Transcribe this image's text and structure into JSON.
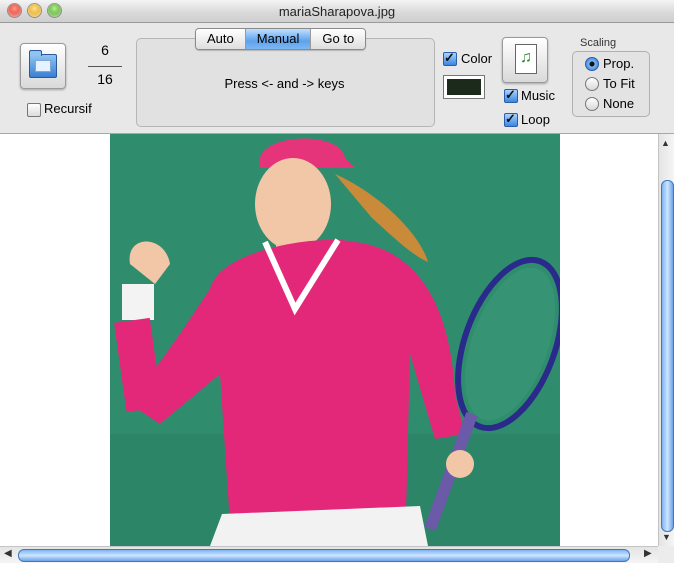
{
  "window": {
    "title": "mariaSharapova.jpg"
  },
  "toolbar": {
    "open_folder_icon": "folder-icon",
    "counter": {
      "current": "6",
      "total": "16"
    },
    "recursive_label": "Recursif",
    "recursive_checked": false,
    "modes": [
      {
        "label": "Auto",
        "active": false
      },
      {
        "label": "Manual",
        "active": true
      },
      {
        "label": "Go to",
        "active": false
      }
    ],
    "instruction": "Press <- and -> keys",
    "color_label": "Color",
    "color_checked": true,
    "color_value": "#1c2a1c",
    "music_icon": "music-note-document-icon",
    "music_label": "Music",
    "music_checked": true,
    "loop_label": "Loop",
    "loop_checked": true,
    "scaling": {
      "label": "Scaling",
      "options": [
        {
          "label": "Prop.",
          "selected": true
        },
        {
          "label": "To Fit",
          "selected": false
        },
        {
          "label": "None",
          "selected": false
        }
      ]
    }
  },
  "viewer": {
    "image_subject": "tennis player in pink top holding a racket",
    "background_color": "#2f8d6e"
  }
}
